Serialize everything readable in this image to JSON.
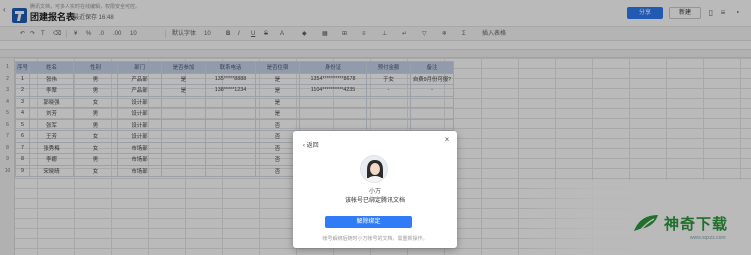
{
  "header": {
    "notice": "腾讯文档，可多人实时在线编辑，权限安全可控。",
    "title": "团建报名表",
    "save_status": "最近保存 16:48",
    "share_label": "分享",
    "new_label": "新建"
  },
  "toolbar": {
    "font_size_label": "10",
    "percent_label": "%",
    "decimal_label": ".0",
    "zero_label": ".00",
    "font_label": "默认字体",
    "font_size": "10",
    "bold_label": "B",
    "italic_label": "I",
    "underline_label": "U",
    "strike_label": "S",
    "more_label": "插入表格"
  },
  "sheet": {
    "headers": [
      "序号",
      "姓名",
      "性别",
      "部门",
      "是否参加",
      "联系电话",
      "是否住宿",
      "身份证",
      "预付金额",
      "备注"
    ],
    "rows": [
      [
        "1",
        "张伟",
        "男",
        "产品部",
        "是",
        "135*****8888",
        "是",
        "1354**********8678",
        "于女",
        "自费9月份可报?"
      ],
      [
        "2",
        "李翠",
        "男",
        "产品部",
        "是",
        "138*****1234",
        "是",
        "1104**********4235",
        "-",
        "-"
      ],
      [
        "3",
        "郭晓强",
        "女",
        "设计部",
        "",
        "",
        "是",
        "",
        "",
        ""
      ],
      [
        "4",
        "刘芳",
        "男",
        "设计部",
        "",
        "",
        "是",
        "",
        "",
        ""
      ],
      [
        "5",
        "张军",
        "男",
        "设计部",
        "",
        "",
        "否",
        "",
        "",
        ""
      ],
      [
        "6",
        "王芳",
        "女",
        "设计部",
        "",
        "",
        "否",
        "",
        "",
        ""
      ],
      [
        "7",
        "张秀梅",
        "女",
        "市场部",
        "",
        "",
        "否",
        "",
        "",
        ""
      ],
      [
        "8",
        "李娜",
        "男",
        "市场部",
        "",
        "",
        "否",
        "",
        "",
        ""
      ],
      [
        "9",
        "宋晓晴",
        "女",
        "市场部",
        "",
        "",
        "否",
        "",
        "",
        ""
      ]
    ]
  },
  "dialog": {
    "back_label": "返回",
    "user_name": "小万",
    "description": "该帐号已绑定腾讯文档",
    "unbind_label": "解除绑定",
    "note": "帐号解绑后随时小万帐号的文档，需重新操作。"
  },
  "watermark": {
    "brand": "神奇下载",
    "url": "www.sqxzz.com"
  },
  "colors": {
    "accent": "#2f7cf6",
    "header_row": "#c7d5ec",
    "brand_green": "#2c9a3c",
    "logo_blue": "#1f5fb8"
  }
}
